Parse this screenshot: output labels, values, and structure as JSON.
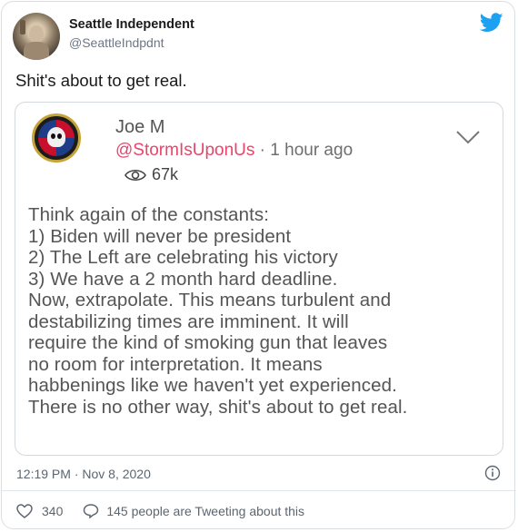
{
  "tweet": {
    "author_name": "Seattle Independent",
    "author_handle": "@SeattleIndpdnt",
    "text": "Shit's about to get real.",
    "timestamp": "12:19 PM · Nov 8, 2020",
    "likes": "340",
    "replies_text": "145 people are Tweeting about this"
  },
  "quoted": {
    "name": "Joe M",
    "handle": "@StormIsUponUs",
    "separator": " · ",
    "time": "1 hour ago",
    "views": "67k",
    "body_lines": [
      "Think again of the constants:",
      "1) Biden will never be president",
      "2) The Left are celebrating his victory",
      "3) We have a 2 month hard deadline.",
      "Now, extrapolate. This means turbulent and",
      "destabilizing times are imminent. It will",
      "require the kind of smoking gun that leaves",
      "no room for interpretation. It means",
      "habbenings like we haven't yet experienced.",
      "There is no other way, shit's about to get real."
    ]
  },
  "icons": {
    "brand": "twitter-bird-icon",
    "views": "eye-icon",
    "menu": "chevron-down-icon",
    "info": "info-icon",
    "like": "heart-icon",
    "reply": "speech-bubble-icon"
  },
  "colors": {
    "twitter_blue": "#1da1f2",
    "handle_pink": "#e8456b"
  }
}
